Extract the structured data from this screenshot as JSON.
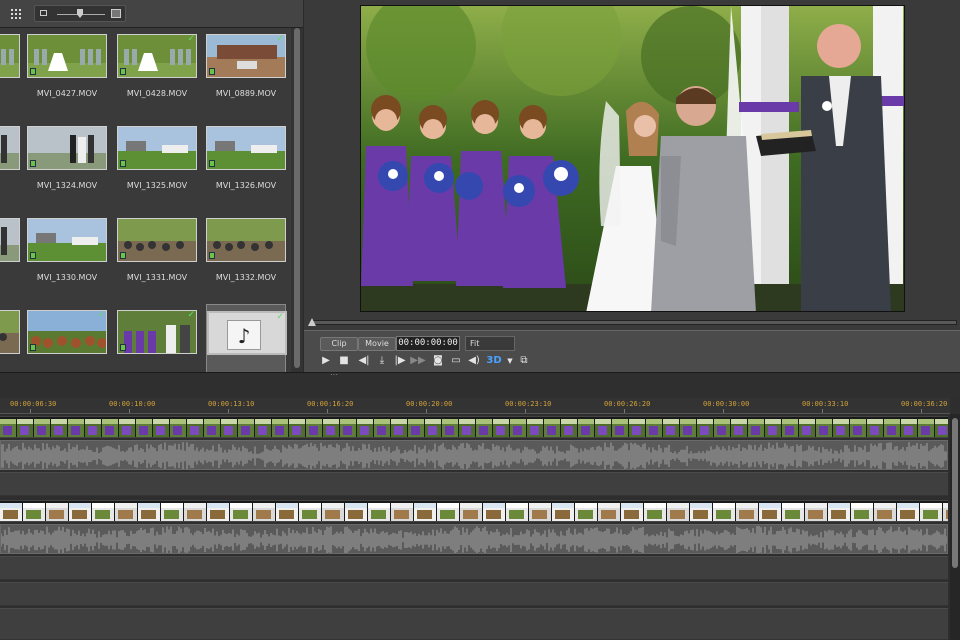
{
  "library": {
    "clips": [
      {
        "label": "",
        "scene": "wedding-party",
        "badge": true
      },
      {
        "label": "MVI_0427.MOV",
        "scene": "wedding-party",
        "badge": true,
        "check": false
      },
      {
        "label": "MVI_0428.MOV",
        "scene": "wedding-party",
        "badge": true,
        "check": true
      },
      {
        "label": "MVI_0889.MOV",
        "scene": "venue",
        "badge": true,
        "check": true
      },
      {
        "label": "",
        "scene": "ceremony",
        "badge": true
      },
      {
        "label": "MVI_1324.MOV",
        "scene": "ceremony",
        "badge": true
      },
      {
        "label": "MVI_1325.MOV",
        "scene": "lawn",
        "badge": true
      },
      {
        "label": "MVI_1326.MOV",
        "scene": "lawn",
        "badge": true
      },
      {
        "label": "",
        "scene": "ceremony",
        "badge": true
      },
      {
        "label": "MVI_1330.MOV",
        "scene": "lawn",
        "badge": true
      },
      {
        "label": "MVI_1331.MOV",
        "scene": "guests",
        "badge": true
      },
      {
        "label": "MVI_1332.MOV",
        "scene": "guests",
        "badge": true
      },
      {
        "label": "",
        "scene": "guests",
        "badge": true
      },
      {
        "label": "",
        "scene": "guests-wide",
        "badge": true,
        "check": true
      },
      {
        "label": "",
        "scene": "purple-party",
        "badge": true,
        "check": true
      },
      {
        "label": "",
        "scene": "audio",
        "badge": false,
        "check": true
      }
    ],
    "check_glyph": "✓",
    "audio_glyph": "♪"
  },
  "preview": {
    "mode_clip": "Clip",
    "mode_movie": "Movie",
    "timecode": "00:00:00:00",
    "fit": "Fit",
    "threed": "3D",
    "icons": [
      "play-icon",
      "stop-icon",
      "previous-frame-icon",
      "trim-icon",
      "next-frame-icon",
      "fast-forward-icon",
      "snapshot-icon",
      "external-display-icon",
      "volume-icon",
      "3d-icon",
      "dropdown-icon",
      "undock-icon"
    ]
  },
  "timeline": {
    "ticks": [
      "00:00:06:30",
      "00:00:10:00",
      "00:00:13:10",
      "00:00:16:20",
      "00:00:20:00",
      "00:00:23:10",
      "00:00:26:20",
      "00:00:30:00",
      "00:00:33:10",
      "00:00:36:20"
    ]
  },
  "colors": {
    "accent": "#4aa3ff",
    "ruler_text": "#d4a23a",
    "badge": "#6cc34a",
    "check": "#5fe05f",
    "purple": "#6a3aa8"
  }
}
